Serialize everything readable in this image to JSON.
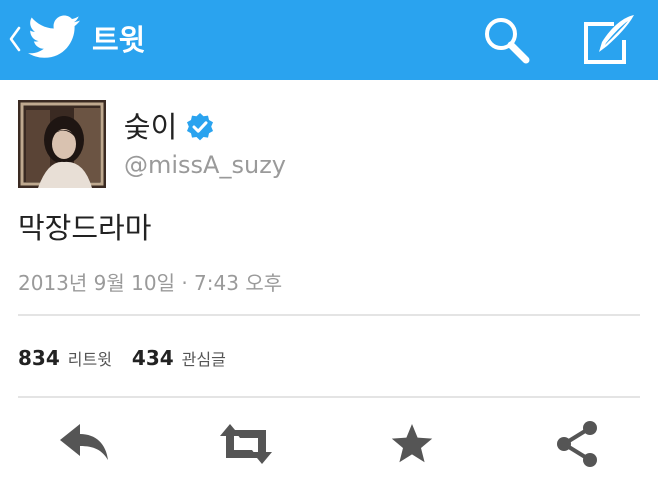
{
  "topbar": {
    "title": "트윗",
    "background_color": "#2aa3ef",
    "back_icon": "chevron-left-icon",
    "logo_icon": "twitter-bird-icon",
    "search_icon": "search-icon",
    "compose_icon": "compose-icon"
  },
  "tweet": {
    "display_name": "숮이",
    "verified": true,
    "verified_color": "#2aa3ef",
    "handle": "@missA_suzy",
    "text": "막장드라마",
    "timestamp": "2013년 9월 10일 · 7:43 오후",
    "stats": {
      "retweets_count": "834",
      "retweets_label": "리트윗",
      "favorites_count": "434",
      "favorites_label": "관심글"
    }
  },
  "actions": {
    "reply_icon": "reply-icon",
    "retweet_icon": "retweet-icon",
    "favorite_icon": "star-icon",
    "share_icon": "share-icon",
    "icon_color": "#555555"
  }
}
